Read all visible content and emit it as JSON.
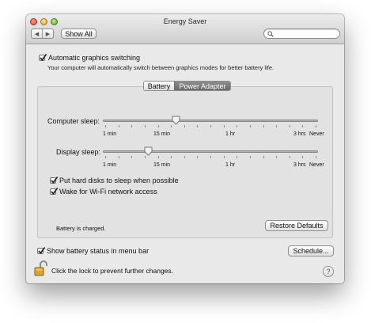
{
  "window": {
    "title": "Energy Saver"
  },
  "toolbar": {
    "back_glyph": "◀",
    "forward_glyph": "▶",
    "show_all_label": "Show All",
    "search_value": "",
    "search_icon": "magnifier-icon"
  },
  "graphics": {
    "switching_label": "Automatic graphics switching",
    "switching_checked": true,
    "switching_desc": "Your computer will automatically switch between graphics modes for better battery life."
  },
  "tabs": [
    {
      "label": "Battery",
      "active": false
    },
    {
      "label": "Power Adapter",
      "active": true
    }
  ],
  "computer_sleep": {
    "label": "Computer sleep:",
    "level": 0.34,
    "ticks": [
      "1 min",
      "15 min",
      "1 hr",
      "3 hrs",
      "Never"
    ]
  },
  "display_sleep": {
    "label": "Display sleep:",
    "level": 0.21,
    "ticks": [
      "1 min",
      "15 min",
      "1 hr",
      "3 hrs",
      "Never"
    ]
  },
  "options": {
    "disks_label": "Put hard disks to sleep when possible",
    "disks_checked": true,
    "wifi_label": "Wake for Wi-Fi network access",
    "wifi_checked": true
  },
  "status": {
    "battery_text": "Battery is charged.",
    "restore_label": "Restore Defaults"
  },
  "footer": {
    "menu_bar_label": "Show battery status in menu bar",
    "menu_bar_checked": true,
    "schedule_label": "Schedule...",
    "lock_text": "Click the lock to prevent further changes.",
    "lock_icon": "padlock-open-icon",
    "help_label": "?"
  }
}
